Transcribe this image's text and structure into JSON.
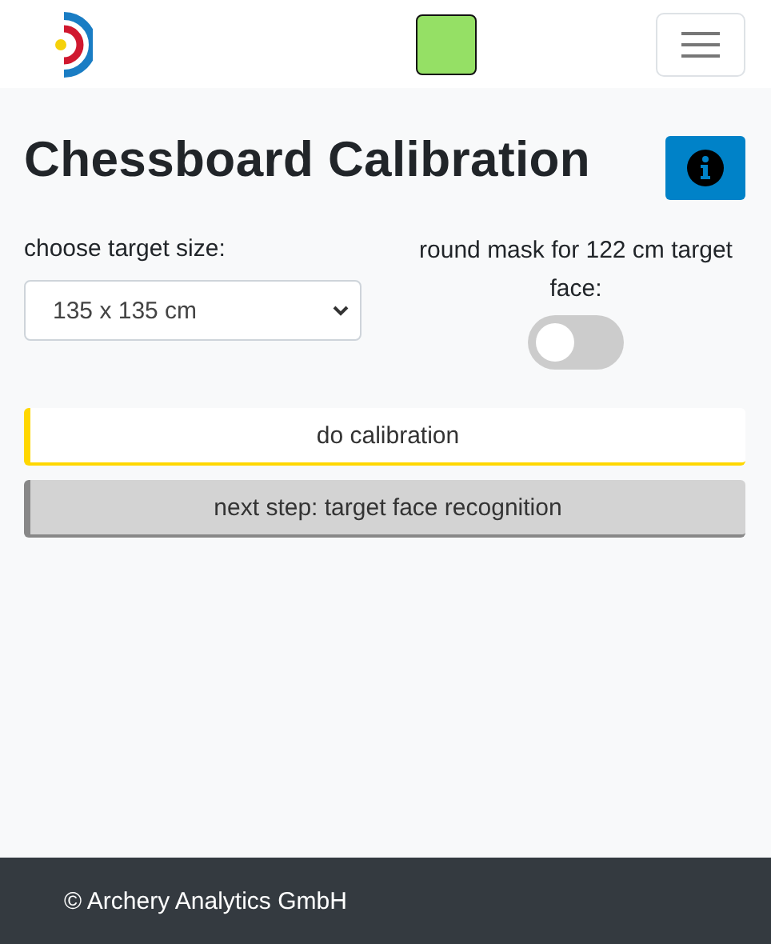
{
  "header": {
    "status_indicator": {
      "color": "#95e065"
    }
  },
  "title": "Chessboard Calibration",
  "target_size": {
    "label": "choose target size:",
    "value": "135 x 135 cm"
  },
  "round_mask": {
    "label": "round mask for 122 cm target face:",
    "on": false
  },
  "steps": [
    {
      "label": "do calibration",
      "disabled": false
    },
    {
      "label": "next step: target face recognition",
      "disabled": true
    }
  ],
  "footer": "© Archery Analytics GmbH"
}
